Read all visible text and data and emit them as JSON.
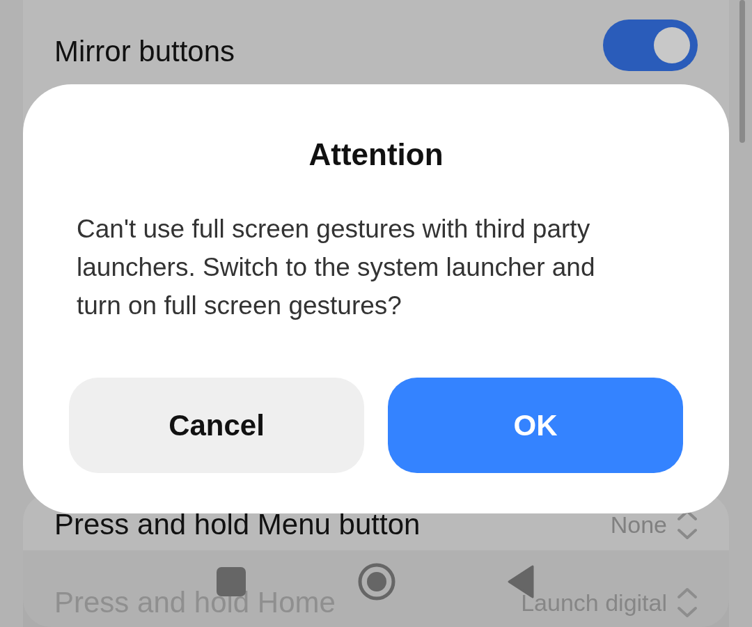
{
  "settings": {
    "items": [
      {
        "kind": "toggle",
        "title": "Mirror buttons",
        "on": true
      },
      {
        "kind": "select",
        "title": "Press and hold Menu button",
        "value": "None"
      },
      {
        "kind": "select",
        "title": "Press and hold Home",
        "value": "Launch digital"
      }
    ]
  },
  "dialog": {
    "title": "Attention",
    "message": "Can't use full screen gestures with third party launchers. Switch to the system launcher and turn on full screen gestures?",
    "buttons": [
      {
        "label": "Cancel",
        "kind": "secondary"
      },
      {
        "label": "OK",
        "kind": "primary"
      }
    ]
  }
}
